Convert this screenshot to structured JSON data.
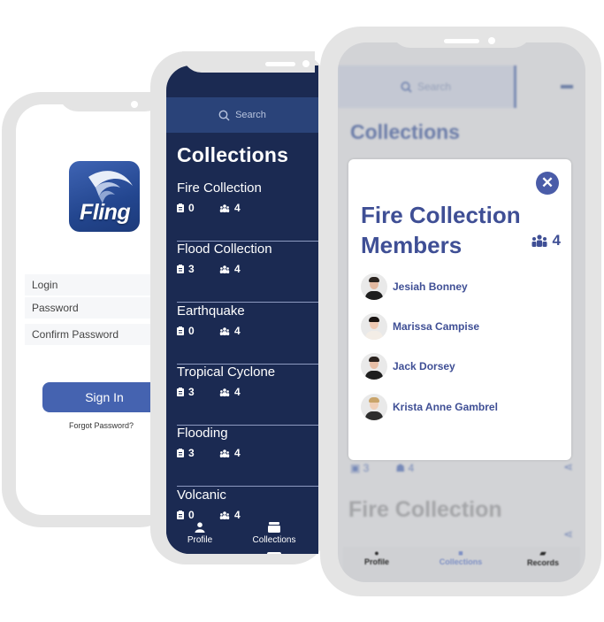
{
  "login_screen": {
    "logo_text": "Fling",
    "fields": [
      {
        "label": "Login"
      },
      {
        "label": "Password"
      },
      {
        "label": "Confirm Password"
      }
    ],
    "sign_in_label": "Sign In",
    "forgot_password_label": "Forgot Password?"
  },
  "collections_screen": {
    "search_placeholder": "Search",
    "title": "Collections",
    "items": [
      {
        "name": "Fire Collection",
        "records": "0",
        "members": "4"
      },
      {
        "name": "Flood Collection",
        "records": "3",
        "members": "4"
      },
      {
        "name": "Earthquake",
        "records": "0",
        "members": "4"
      },
      {
        "name": "Tropical Cyclone",
        "records": "3",
        "members": "4"
      },
      {
        "name": "Flooding",
        "records": "3",
        "members": "4"
      },
      {
        "name": "Volcanic",
        "records": "0",
        "members": "4"
      }
    ],
    "nav": [
      {
        "label": "Profile",
        "icon": "profile-icon"
      },
      {
        "label": "Collections",
        "icon": "collections-icon"
      }
    ]
  },
  "members_screen": {
    "background": {
      "search_placeholder": "Search",
      "title": "Collections",
      "item_meta": {
        "records": "3",
        "members": "4"
      },
      "second_item_title": "Fire Collection",
      "nav": [
        {
          "label": "Profile"
        },
        {
          "label": "Collections"
        },
        {
          "label": "Records"
        }
      ]
    },
    "modal": {
      "title": "Fire Collection Members",
      "member_count": "4",
      "close_icon": "close-icon",
      "members": [
        {
          "name": "Jesiah Bonney"
        },
        {
          "name": "Marissa Campise"
        },
        {
          "name": "Jack Dorsey"
        },
        {
          "name": "Krista Anne Gambrel"
        }
      ]
    }
  },
  "colors": {
    "brand_blue": "#4563b0",
    "dark_navy": "#1b2a52",
    "modal_accent": "#3f4f95",
    "frame_gray": "#e4e4e4"
  }
}
